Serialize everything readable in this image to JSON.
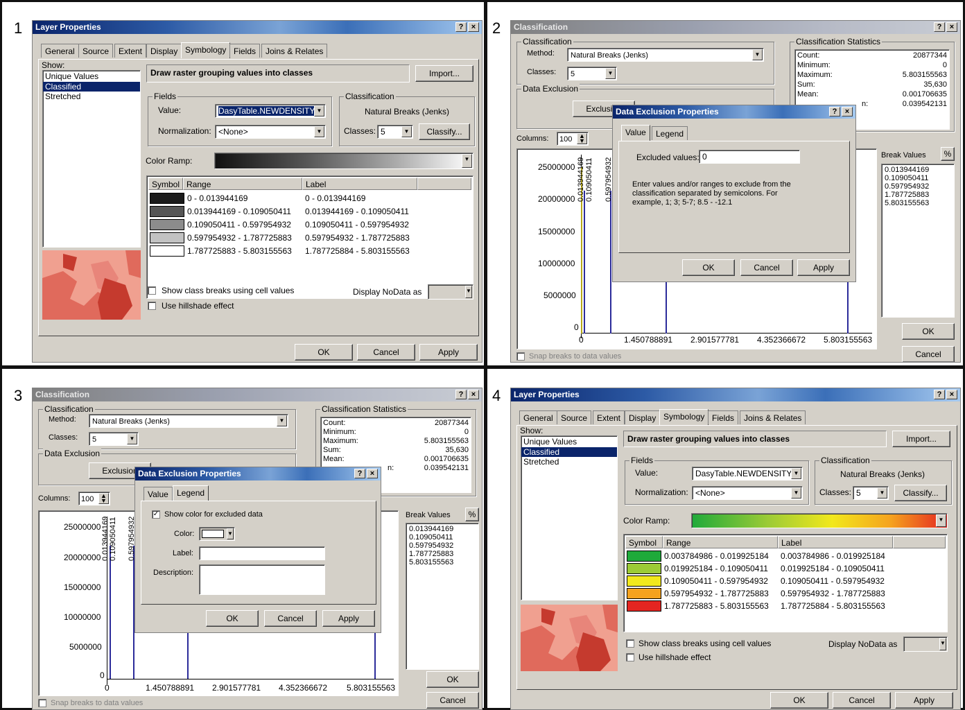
{
  "panel_numbers": [
    "1",
    "2",
    "3",
    "4"
  ],
  "p1": {
    "title": "Layer Properties",
    "tabs": [
      "General",
      "Source",
      "Extent",
      "Display",
      "Symbology",
      "Fields",
      "Joins & Relates"
    ],
    "show_label": "Show:",
    "show_items": [
      "Unique Values",
      "Classified",
      "Stretched"
    ],
    "header": "Draw raster grouping values into classes",
    "import": "Import...",
    "fields_label": "Fields",
    "value_label": "Value:",
    "value": "DasyTable.NEWDENSITY",
    "norm_label": "Normalization:",
    "norm": "<None>",
    "class_label": "Classification",
    "method": "Natural Breaks (Jenks)",
    "classes_label": "Classes:",
    "classes": "5",
    "classify": "Classify...",
    "ramp_label": "Color Ramp:",
    "col_symbol": "Symbol",
    "col_range": "Range",
    "col_label": "Label",
    "rows": [
      {
        "range": "0 - 0.013944169",
        "label": "0 - 0.013944169",
        "color": "#1a1a1a"
      },
      {
        "range": "0.013944169 - 0.109050411",
        "label": "0.013944169 - 0.109050411",
        "color": "#555555"
      },
      {
        "range": "0.109050411 - 0.597954932",
        "label": "0.109050411 - 0.597954932",
        "color": "#8c8c8c"
      },
      {
        "range": "0.597954932 - 1.787725883",
        "label": "0.597954932 - 1.787725883",
        "color": "#c2c2c2"
      },
      {
        "range": "1.787725883 - 5.803155563",
        "label": "1.787725884 - 5.803155563",
        "color": "#ffffff"
      }
    ],
    "chk1": "Show class breaks using cell values",
    "chk2": "Use hillshade effect",
    "nodata": "Display NoData as",
    "ok": "OK",
    "cancel": "Cancel",
    "apply": "Apply"
  },
  "p2": {
    "title": "Classification",
    "class_group": "Classification",
    "method_label": "Method:",
    "method": "Natural Breaks (Jenks)",
    "classes_label": "Classes:",
    "classes": "5",
    "excl_group": "Data Exclusion",
    "exclusion": "Exclusion",
    "stats_group": "Classification Statistics",
    "stats": [
      [
        "Count:",
        "20877344"
      ],
      [
        "Minimum:",
        "0"
      ],
      [
        "Maximum:",
        "5.803155563"
      ],
      [
        "Sum:",
        "35,630"
      ],
      [
        "Mean:",
        "0.001706635"
      ],
      [
        "",
        "0.039542131"
      ]
    ],
    "stats_partial": "n:",
    "columns_label": "Columns:",
    "columns": "100",
    "yticks": [
      "25000000",
      "20000000",
      "15000000",
      "10000000",
      "5000000",
      "0"
    ],
    "xticks": [
      "0",
      "1.450788891",
      "2.901577781",
      "4.352366672",
      "5.803155563"
    ],
    "bar_labels": [
      "0.013944169",
      "0.109050411",
      "0.597954932"
    ],
    "break_label": "Break Values",
    "pct": "%",
    "breaks": [
      "0.013944169",
      "0.109050411",
      "0.597954932",
      "1.787725883",
      "5.803155563"
    ],
    "snap": "Snap breaks to data values",
    "ok": "OK",
    "cancel": "Cancel",
    "dlg": {
      "title": "Data Exclusion Properties",
      "tabs": [
        "Value",
        "Legend"
      ],
      "excluded_label": "Excluded values:",
      "excluded_value": "0",
      "help": "Enter values and/or ranges to exclude from the classification separated by semicolons. For example, 1; 3; 5-7; 8.5 - -12.1",
      "ok": "OK",
      "cancel": "Cancel",
      "apply": "Apply"
    }
  },
  "p3": {
    "dlg": {
      "title": "Data Exclusion Properties",
      "tabs": [
        "Value",
        "Legend"
      ],
      "show_color": "Show color for excluded data",
      "color_label": "Color:",
      "label_label": "Label:",
      "desc_label": "Description:",
      "ok": "OK",
      "cancel": "Cancel",
      "apply": "Apply"
    }
  },
  "p4": {
    "title": "Layer Properties",
    "rows": [
      {
        "range": "0.003784986 - 0.019925184",
        "label": "0.003784986 - 0.019925184",
        "color": "#1faa3a"
      },
      {
        "range": "0.019925184 - 0.109050411",
        "label": "0.019925184 - 0.109050411",
        "color": "#9ccb36"
      },
      {
        "range": "0.109050411 - 0.597954932",
        "label": "0.109050411 - 0.597954932",
        "color": "#f2e81c"
      },
      {
        "range": "0.597954932 - 1.787725883",
        "label": "0.597954932 - 1.787725883",
        "color": "#f5a21e"
      },
      {
        "range": "1.787725883 - 5.803155563",
        "label": "1.787725884 - 5.803155563",
        "color": "#e42521"
      }
    ]
  },
  "chart_data": [
    {
      "type": "bar",
      "title": "",
      "xlabel": "",
      "ylabel": "",
      "ylim": [
        0,
        25000000
      ],
      "x": [
        0,
        0.013944169,
        0.109050411,
        0.597954932,
        1.787725883,
        5.803155563
      ],
      "xticks": [
        0,
        1.450788891,
        2.901577781,
        4.352366672,
        5.803155563
      ],
      "series": [
        {
          "values": [
            25000000,
            0,
            0,
            0,
            0,
            0
          ]
        }
      ]
    }
  ]
}
